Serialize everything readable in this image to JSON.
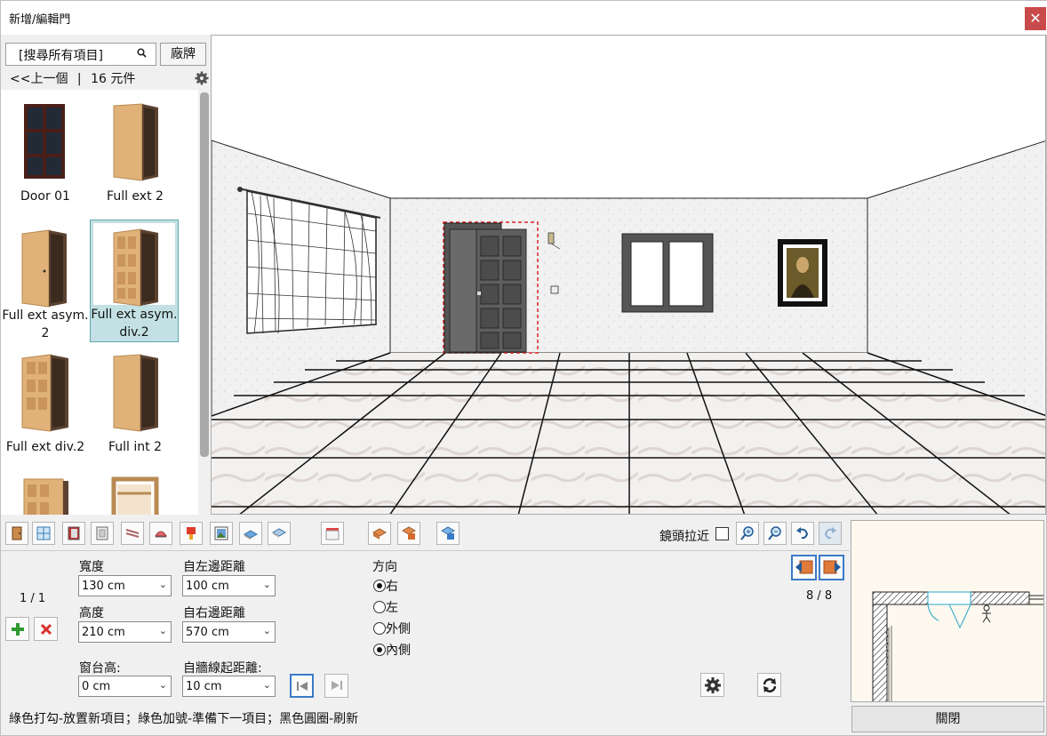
{
  "window": {
    "title": "新增/編輯門",
    "close_symbol": "✕"
  },
  "sidebar": {
    "search_placeholder": "[搜尋所有項目]",
    "brand_button": "廠牌",
    "prev_link": "<<上一個",
    "item_count": "16 元件",
    "items": [
      {
        "label": "Door 01"
      },
      {
        "label": "Full ext 2"
      },
      {
        "label": "Full ext asym. 2"
      },
      {
        "label": "Full ext asym. div.2",
        "selected": true
      },
      {
        "label": "Full ext div.2"
      },
      {
        "label": "Full int 2"
      }
    ]
  },
  "toolbar": {
    "zoom_label": "鏡頭拉近",
    "icons": [
      "door-icon",
      "window-icon",
      "panel-door-icon",
      "frame-icon",
      "blinds-icon",
      "lamp-icon",
      "paint-icon",
      "picture-icon",
      "floor-view-icon",
      "ceiling-view-icon",
      "curtain-icon",
      "wall-left-icon",
      "wall-right-icon",
      "room-icon"
    ]
  },
  "form": {
    "index_text": "1 / 1",
    "width_label": "寬度",
    "width_value": "130 cm",
    "height_label": "高度",
    "height_value": "210 cm",
    "sill_label": "窗台高:",
    "sill_value": "0 cm",
    "left_dist_label": "自左邊距離",
    "left_dist_value": "100 cm",
    "right_dist_label": "自右邊距離",
    "right_dist_value": "570 cm",
    "wall_line_label": "自牆線起距離:",
    "wall_line_value": "10 cm",
    "direction_label": "方向",
    "options": [
      {
        "label": "右",
        "checked": true
      },
      {
        "label": "左",
        "checked": false
      },
      {
        "label": "外側",
        "checked": false
      },
      {
        "label": "內側",
        "checked": true
      }
    ],
    "wall_counter": "8 / 8"
  },
  "status_text": "綠色打勾-放置新項目；綠色加號-準備下一項目；黑色圓圈-刷新",
  "close_button": "關閉",
  "colors": {
    "accent_red": "#c94a4a",
    "selection": "#c3e1e4",
    "add_green": "#2e9a2e",
    "remove_red": "#d9302c"
  }
}
